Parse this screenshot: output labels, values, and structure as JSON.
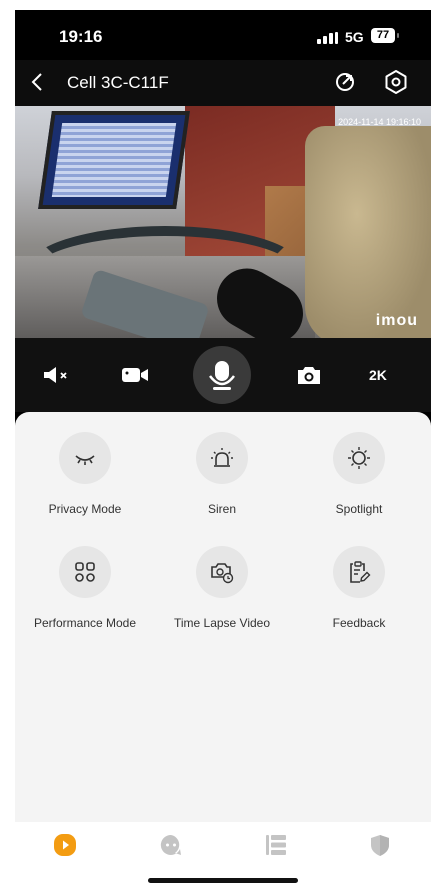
{
  "status": {
    "time": "19:16",
    "network": "5G",
    "battery": "77"
  },
  "nav": {
    "title": "Cell 3C-C11F"
  },
  "video": {
    "timestamp": "2024-11-14 19:16:10",
    "brand": "imou"
  },
  "controls": {
    "resolution": "2K"
  },
  "features": [
    {
      "label": "Privacy Mode",
      "icon": "eye-closed-icon"
    },
    {
      "label": "Siren",
      "icon": "siren-icon"
    },
    {
      "label": "Spotlight",
      "icon": "light-bulb-icon"
    },
    {
      "label": "Performance Mode",
      "icon": "grid-icon"
    },
    {
      "label": "Time Lapse Video",
      "icon": "camera-clock-icon"
    },
    {
      "label": "Feedback",
      "icon": "clipboard-edit-icon"
    }
  ],
  "tabs": [
    {
      "name": "live",
      "icon": "play-icon",
      "active": true
    },
    {
      "name": "messages",
      "icon": "chat-icon",
      "active": false
    },
    {
      "name": "records",
      "icon": "list-icon",
      "active": false
    },
    {
      "name": "security",
      "icon": "shield-icon",
      "active": false
    }
  ],
  "colors": {
    "accent": "#f39c12",
    "panel": "#f4f4f4",
    "inactive": "#c4c4c4"
  }
}
